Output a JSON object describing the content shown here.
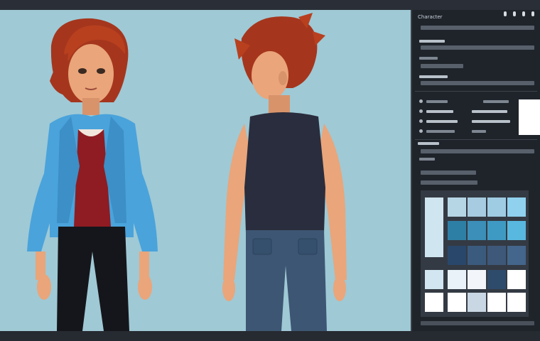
{
  "panel": {
    "title": "Сharacter",
    "icons": [
      "pin-icon",
      "settings-icon",
      "menu-icon",
      "close-icon"
    ]
  },
  "palette": {
    "swatches": [
      "#cfe5f0",
      "#b6d6e6",
      "#a7cbe0",
      "#9fcbe3",
      "#8fd1ef",
      "#2e7fa6",
      "#3b8fb8",
      "#3f9ac3",
      "#58b8e0",
      "#29476a",
      "#3a5b7e",
      "#3e587a",
      "#44668c",
      "#d2e6f1",
      "#e8f2f8",
      "#f2f6fa",
      "#2f4b6b",
      "#ffffff",
      "#ffffff",
      "#ffffff",
      "#c8d7e3",
      "#ffffff"
    ]
  },
  "colors": {
    "canvas": "#9fc9d5",
    "hair": "#a5361d",
    "jacket": "#4aa3db",
    "top": "#8e1c22",
    "jeans_dark": "#15161b",
    "tank": "#2a2d3d",
    "jeans_blue": "#3d5673",
    "skin": "#eaa57a"
  }
}
